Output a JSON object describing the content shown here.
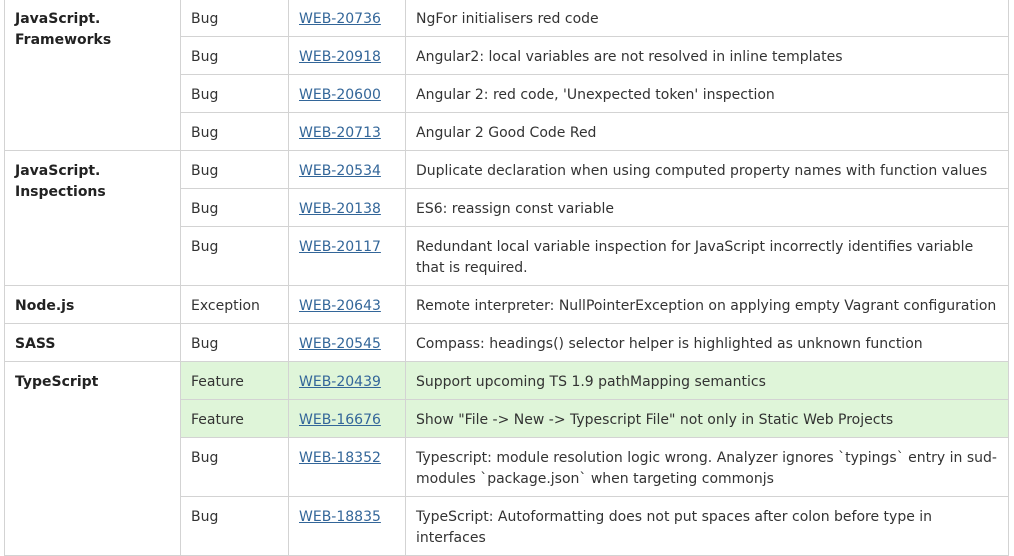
{
  "groups": [
    {
      "subsystem": [
        "JavaScript.",
        "Frameworks"
      ],
      "rows": [
        {
          "type": "Bug",
          "issue": "WEB-20736",
          "summary": "NgFor initialisers red code",
          "feature": false
        },
        {
          "type": "Bug",
          "issue": "WEB-20918",
          "summary": "Angular2: local variables are not resolved in inline templates",
          "feature": false
        },
        {
          "type": "Bug",
          "issue": "WEB-20600",
          "summary": "Angular 2: red code, 'Unexpected token' inspection",
          "feature": false
        },
        {
          "type": "Bug",
          "issue": "WEB-20713",
          "summary": "Angular 2 Good Code Red",
          "feature": false
        }
      ]
    },
    {
      "subsystem": [
        "JavaScript.",
        "Inspections"
      ],
      "rows": [
        {
          "type": "Bug",
          "issue": "WEB-20534",
          "summary": "Duplicate declaration when using computed property names with function values",
          "feature": false
        },
        {
          "type": "Bug",
          "issue": "WEB-20138",
          "summary": "ES6: reassign const variable",
          "feature": false
        },
        {
          "type": "Bug",
          "issue": "WEB-20117",
          "summary": "Redundant local variable inspection for JavaScript incorrectly identifies variable that is required.",
          "feature": false
        }
      ]
    },
    {
      "subsystem": [
        "Node.js"
      ],
      "rows": [
        {
          "type": "Exception",
          "issue": "WEB-20643",
          "summary": "Remote interpreter: NullPointerException on applying empty Vagrant configuration",
          "feature": false
        }
      ]
    },
    {
      "subsystem": [
        "SASS"
      ],
      "rows": [
        {
          "type": "Bug",
          "issue": "WEB-20545",
          "summary": "Compass: headings() selector helper is highlighted as unknown function",
          "feature": false
        }
      ]
    },
    {
      "subsystem": [
        "TypeScript"
      ],
      "rows": [
        {
          "type": "Feature",
          "issue": "WEB-20439",
          "summary": "Support upcoming TS 1.9 pathMapping semantics",
          "feature": true
        },
        {
          "type": "Feature",
          "issue": "WEB-16676",
          "summary": "Show \"File -> New -> Typescript File\" not only in Static Web Projects",
          "feature": true
        },
        {
          "type": "Bug",
          "issue": "WEB-18352",
          "summary": "Typescript: module resolution logic wrong. Analyzer ignores `typings` entry in sud-modules `package.json` when targeting commonjs",
          "feature": false
        },
        {
          "type": "Bug",
          "issue": "WEB-18835",
          "summary": "TypeScript: Autoformatting does not put spaces after colon before type in interfaces",
          "feature": false
        }
      ]
    }
  ],
  "colors": {
    "link": "#336699",
    "feature_row_bg": "#dff5d9",
    "border": "#d3d3d3"
  }
}
